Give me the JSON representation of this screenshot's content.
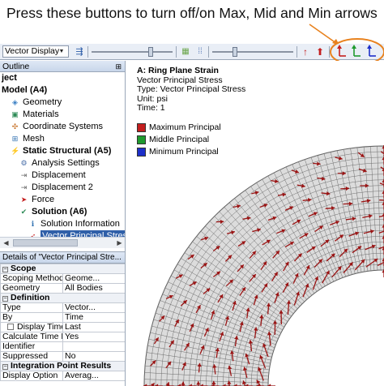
{
  "annotation": {
    "text": "Press these buttons to turn off/on Max, Mid and Min arrows"
  },
  "toolbar": {
    "label": "Vector Display"
  },
  "outline": {
    "title": "Outline",
    "items": [
      {
        "label": "ject",
        "indent": 0,
        "bold": true,
        "icon": "none"
      },
      {
        "label": "Model (A4)",
        "indent": 0,
        "bold": true,
        "icon": "none"
      },
      {
        "label": "Geometry",
        "indent": 1,
        "bold": false,
        "icon": "geometry-icon"
      },
      {
        "label": "Materials",
        "indent": 1,
        "bold": false,
        "icon": "materials-icon"
      },
      {
        "label": "Coordinate Systems",
        "indent": 1,
        "bold": false,
        "icon": "coordinate-systems-icon"
      },
      {
        "label": "Mesh",
        "indent": 1,
        "bold": false,
        "icon": "mesh-icon"
      },
      {
        "label": "Static Structural (A5)",
        "indent": 1,
        "bold": true,
        "icon": "static-structural-icon"
      },
      {
        "label": "Analysis Settings",
        "indent": 2,
        "bold": false,
        "icon": "analysis-settings-icon"
      },
      {
        "label": "Displacement",
        "indent": 2,
        "bold": false,
        "icon": "displacement-icon"
      },
      {
        "label": "Displacement 2",
        "indent": 2,
        "bold": false,
        "icon": "displacement-icon"
      },
      {
        "label": "Force",
        "indent": 2,
        "bold": false,
        "icon": "force-icon"
      },
      {
        "label": "Solution (A6)",
        "indent": 2,
        "bold": true,
        "icon": "solution-icon"
      },
      {
        "label": "Solution Information",
        "indent": 3,
        "bold": false,
        "icon": "solution-information-icon"
      },
      {
        "label": "Vector Principal Stress",
        "indent": 3,
        "bold": false,
        "icon": "vector-principal-stress-icon",
        "selected": true
      }
    ]
  },
  "details": {
    "title": "Details of \"Vector Principal Stre...",
    "rows": [
      {
        "type": "group",
        "label": "Scope"
      },
      {
        "key": "Scoping Method",
        "value": "Geome..."
      },
      {
        "key": "Geometry",
        "value": "All Bodies"
      },
      {
        "type": "group",
        "label": "Definition"
      },
      {
        "key": "Type",
        "value": "Vector..."
      },
      {
        "key": "By",
        "value": "Time"
      },
      {
        "key": "Display Time",
        "value": "Last",
        "checkbox": true
      },
      {
        "key": "Calculate Time History",
        "value": "Yes"
      },
      {
        "key": "Identifier",
        "value": ""
      },
      {
        "key": "Suppressed",
        "value": "No"
      },
      {
        "type": "group",
        "label": "Integration Point Results"
      },
      {
        "key": "Display Option",
        "value": "Averag..."
      }
    ]
  },
  "result": {
    "title": "A: Ring Plane Strain",
    "subtitle": "Vector Principal Stress",
    "type": "Type: Vector Principal Stress",
    "unit": "Unit: psi",
    "time": "Time: 1"
  },
  "legend": [
    {
      "label": "Maximum Principal",
      "color": "#c41e1e"
    },
    {
      "label": "Middle Principal",
      "color": "#1f9a2e"
    },
    {
      "label": "Minimum Principal",
      "color": "#1d2fc9"
    }
  ],
  "colors": {
    "arrow": "#9a1414",
    "mesh": "#6e6e6e",
    "highlight": "#e8821e",
    "selection": "#2f5fa8"
  }
}
